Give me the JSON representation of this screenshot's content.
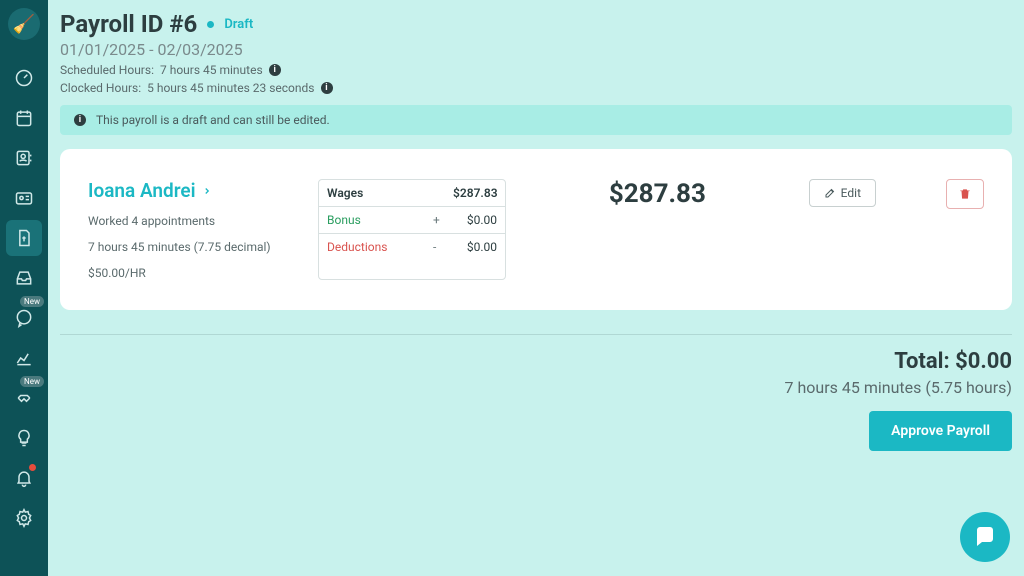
{
  "header": {
    "title": "Payroll ID #6",
    "status": "Draft",
    "date_range": "01/01/2025 - 02/03/2025",
    "scheduled_hours_label": "Scheduled Hours:",
    "scheduled_hours_value": "7 hours 45 minutes",
    "clocked_hours_label": "Clocked Hours:",
    "clocked_hours_value": "5 hours 45 minutes 23 seconds"
  },
  "alert": {
    "text": "This payroll is a draft and can still be edited."
  },
  "employee": {
    "name": "Ioana Andrei",
    "appointments": "Worked 4 appointments",
    "hours": "7 hours 45 minutes (7.75 decimal)",
    "rate": "$50.00/HR",
    "wages_label": "Wages",
    "wages_value": "$287.83",
    "bonus_label": "Bonus",
    "bonus_value": "$0.00",
    "deductions_label": "Deductions",
    "deductions_value": "$0.00",
    "total": "$287.83"
  },
  "actions": {
    "edit_label": "Edit",
    "approve_label": "Approve Payroll"
  },
  "summary": {
    "total_label": "Total:",
    "total_value": "$0.00",
    "hours": "7 hours 45 minutes (5.75 hours)"
  },
  "nav": {
    "new_badge": "New"
  }
}
